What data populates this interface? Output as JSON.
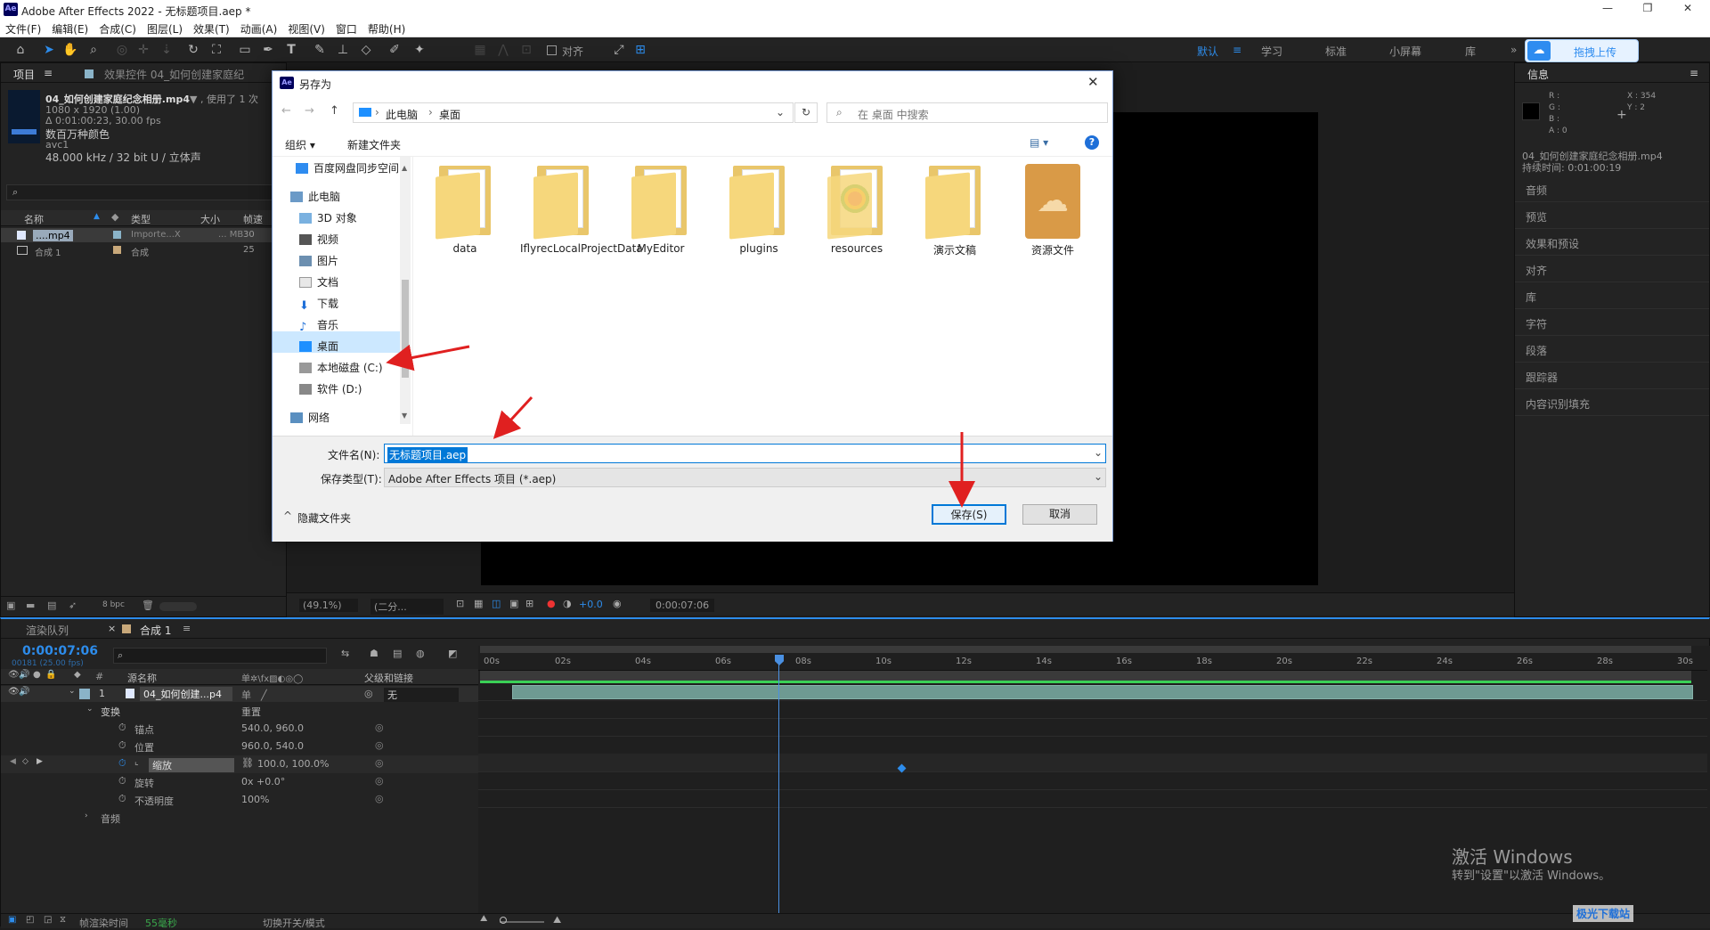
{
  "app": {
    "title": "Adobe After Effects 2022 - 无标题项目.aep *",
    "logo": "Ae"
  },
  "menu": [
    "文件(F)",
    "编辑(E)",
    "合成(C)",
    "图层(L)",
    "效果(T)",
    "动画(A)",
    "视图(V)",
    "窗口",
    "帮助(H)"
  ],
  "toolbar": {
    "align_label": "对齐",
    "workspaces": [
      "默认",
      "学习",
      "标准",
      "小屏幕",
      "库"
    ],
    "upload_label": "拖拽上传"
  },
  "project": {
    "tab": "项目",
    "effects_tab": "效果控件 04_如何创建家庭纪",
    "file_name": "04_如何创建家庭纪念相册.mp4",
    "used": "▼ , 使用了 1 次",
    "dims": "1080 x 1920 (1.00)",
    "duration": "Δ 0:01:00:23, 30.00 fps",
    "color": "数百万种颜色",
    "codec": "avc1",
    "audio": "48.000 kHz / 32 bit U / 立体声",
    "search_icon": "search-icon",
    "columns": [
      "名称",
      "类型",
      "大小",
      "帧速"
    ],
    "rows": [
      {
        "name": "....mp4",
        "type": "Importe...X",
        "size": "... MB",
        "fps": "30"
      },
      {
        "name": "合成 1",
        "type": "合成",
        "size": "",
        "fps": "25"
      }
    ],
    "bpc": "8 bpc"
  },
  "info": {
    "title": "信息",
    "r": "R :",
    "g": "G :",
    "b": "B :",
    "a": "A : 0",
    "x": "X : 354",
    "y": "Y : 2",
    "file": "04_如何创建家庭纪念相册.mp4",
    "duration": "持续时间: 0:01:00:19",
    "panels": [
      "音频",
      "预览",
      "效果和预设",
      "对齐",
      "库",
      "字符",
      "段落",
      "跟踪器",
      "内容识别填充"
    ]
  },
  "viewer": {
    "zoom": "(49.1%)",
    "res": "(二分...",
    "plus": "+0.0",
    "time": "0:00:07:06"
  },
  "dialog": {
    "title": "另存为",
    "breadcrumb": [
      "此电脑",
      "桌面"
    ],
    "search_placeholder": "在 桌面 中搜索",
    "organize": "组织 ▾",
    "new_folder": "新建文件夹",
    "nav": [
      "百度网盘同步空间",
      "此电脑",
      "3D 对象",
      "视频",
      "图片",
      "文档",
      "下载",
      "音乐",
      "桌面",
      "本地磁盘 (C:)",
      "软件 (D:)",
      "网络"
    ],
    "files": [
      "data",
      "IflyrecLocalProjectData",
      "MyEditor",
      "plugins",
      "resources",
      "演示文稿",
      "资源文件"
    ],
    "filename_label": "文件名(N):",
    "filename_value": "无标题项目.aep",
    "filetype_label": "保存类型(T):",
    "filetype_value": "Adobe After Effects 项目 (*.aep)",
    "hide_folders": "隐藏文件夹",
    "save": "保存(S)",
    "cancel": "取消"
  },
  "timeline": {
    "render_tab": "渲染队列",
    "comp_tab": "合成 1",
    "timecode": "0:00:07:06",
    "frames": "00181 (25.00 fps)",
    "col_source": "源名称",
    "col_parent": "父级和链接",
    "layer_num": "1",
    "layer_name": "04_如何创建...p4",
    "parent_value": "无",
    "transform": "变换",
    "reset": "重置",
    "props": [
      {
        "name": "锚点",
        "value": "540.0, 960.0"
      },
      {
        "name": "位置",
        "value": "960.0, 540.0"
      },
      {
        "name": "缩放",
        "value": "100.0, 100.0%"
      },
      {
        "name": "旋转",
        "value": "0x +0.0°"
      },
      {
        "name": "不透明度",
        "value": "100%"
      }
    ],
    "audio": "音频",
    "ticks": [
      "00s",
      "02s",
      "04s",
      "06s",
      "08s",
      "10s",
      "12s",
      "14s",
      "16s",
      "18s",
      "20s",
      "22s",
      "24s",
      "26s",
      "28s",
      "30s"
    ],
    "render_time_label": "帧渲染时间",
    "render_time_value": "55毫秒",
    "switch_mode": "切换开关/模式"
  },
  "watermark": {
    "line1": "激活 Windows",
    "line2": "转到\"设置\"以激活 Windows。",
    "site": "极光下载站"
  }
}
